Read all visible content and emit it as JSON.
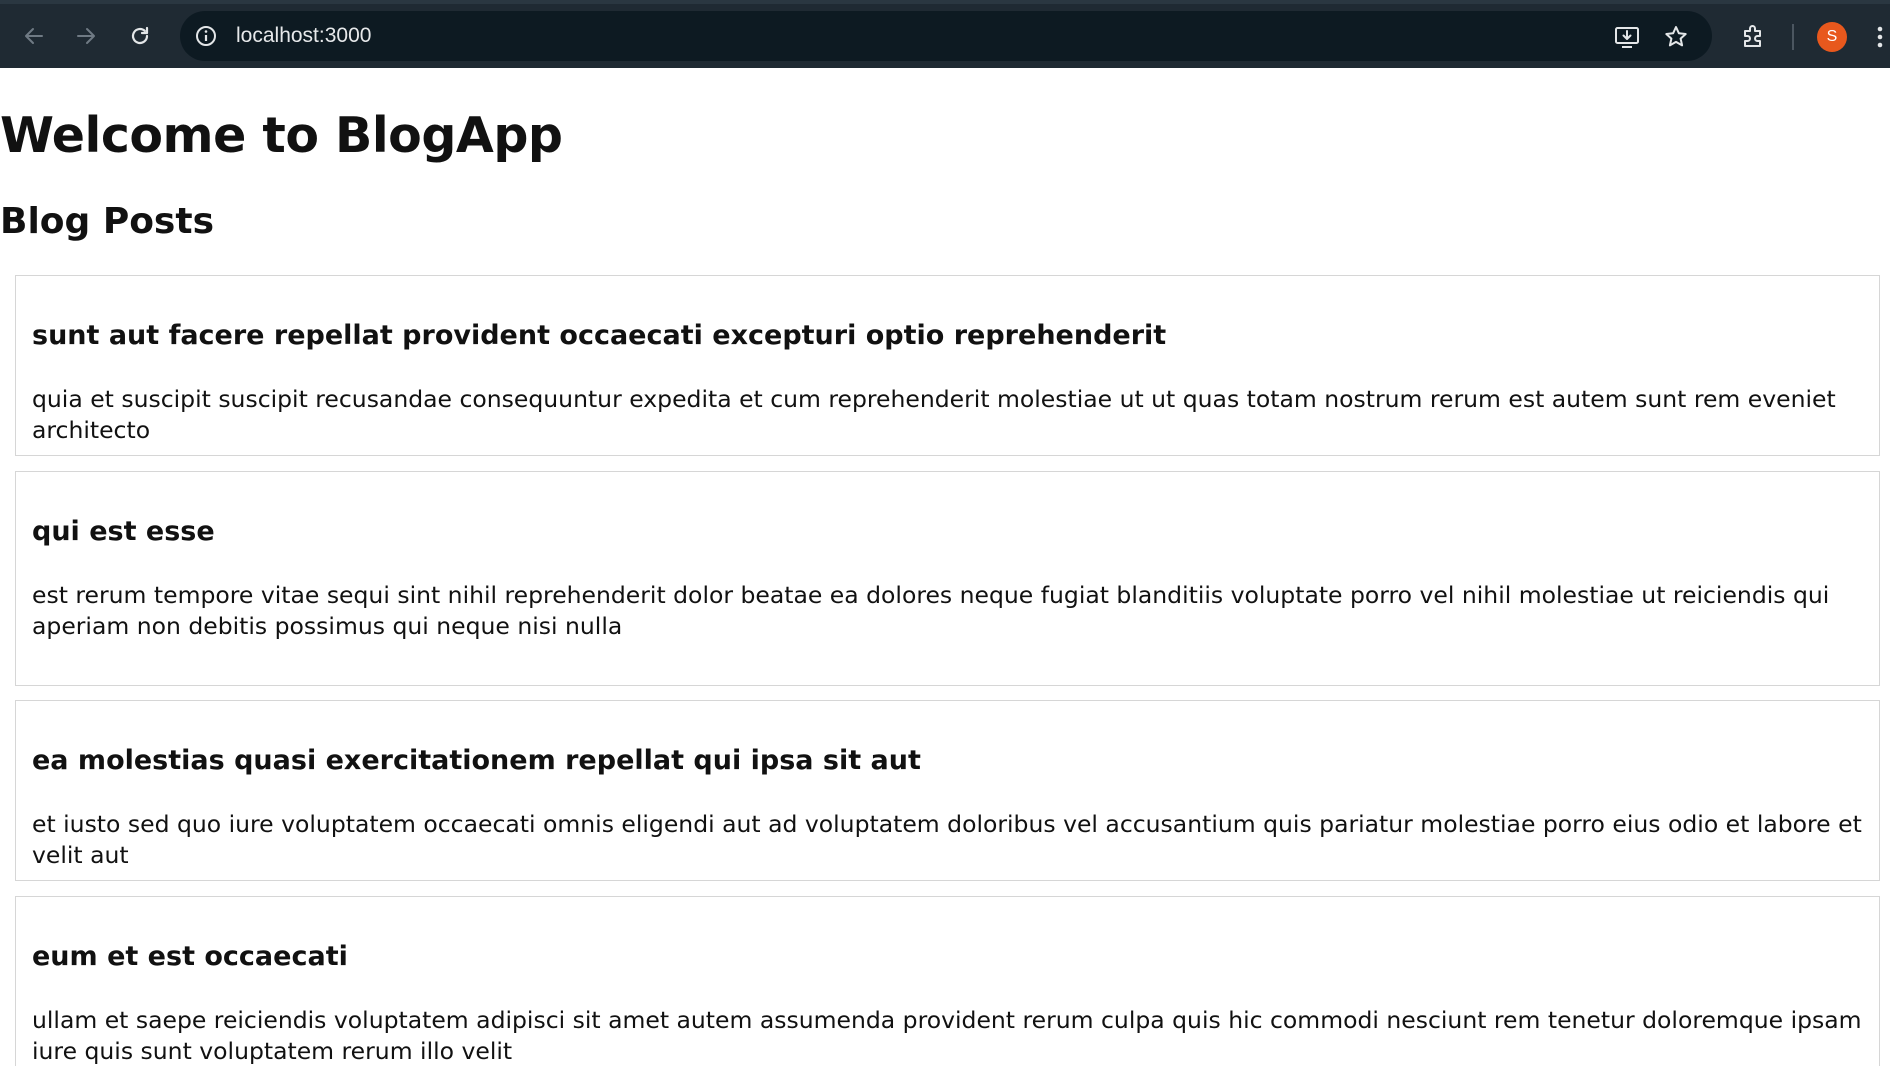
{
  "browser": {
    "url": "localhost:3000",
    "profile_initial": "S",
    "icons": {
      "back": "arrow-left-icon",
      "forward": "arrow-right-icon",
      "reload": "reload-icon",
      "site_info": "info-icon",
      "install": "install-app-icon",
      "bookmark": "star-icon",
      "extensions": "puzzle-icon",
      "menu": "kebab-menu-icon"
    },
    "colors": {
      "toolbar": "#1f2a33",
      "omnibox": "#0d1a22",
      "avatar": "#e8581d"
    }
  },
  "page": {
    "title": "Welcome to BlogApp",
    "section_title": "Blog Posts",
    "posts": [
      {
        "title": "sunt aut facere repellat provident occaecati excepturi optio reprehenderit",
        "body": "quia et suscipit suscipit recusandae consequuntur expedita et cum reprehenderit molestiae ut ut quas totam nostrum rerum est autem sunt rem eveniet architecto"
      },
      {
        "title": "qui est esse",
        "body": "est rerum tempore vitae sequi sint nihil reprehenderit dolor beatae ea dolores neque fugiat blanditiis voluptate porro vel nihil molestiae ut reiciendis qui aperiam non debitis possimus qui neque nisi nulla"
      },
      {
        "title": "ea molestias quasi exercitationem repellat qui ipsa sit aut",
        "body": "et iusto sed quo iure voluptatem occaecati omnis eligendi aut ad voluptatem doloribus vel accusantium quis pariatur molestiae porro eius odio et labore et velit aut"
      },
      {
        "title": "eum et est occaecati",
        "body": "ullam et saepe reiciendis voluptatem adipisci sit amet autem assumenda provident rerum culpa quis hic commodi nesciunt rem tenetur doloremque ipsam iure quis sunt voluptatem rerum illo velit"
      }
    ]
  }
}
